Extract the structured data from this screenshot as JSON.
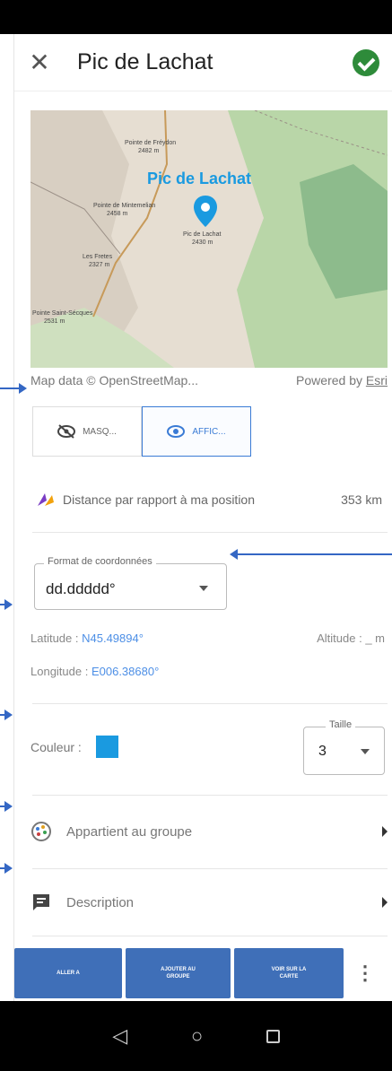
{
  "header": {
    "title": "Pic de Lachat"
  },
  "map": {
    "marker_title": "Pic de Lachat",
    "labels": [
      {
        "name": "Pointe de Fréydon",
        "alt": "2482 m"
      },
      {
        "name": "Pointe de Mintemelian",
        "alt": "2458 m"
      },
      {
        "name": "Pic de Lachat",
        "alt": "2430 m"
      },
      {
        "name": "Les Fretes",
        "alt": "2327 m"
      },
      {
        "name": "Pointe Saint-Sécques",
        "alt": "2531 m"
      }
    ],
    "credit_left": "Map data © OpenStreetMap...",
    "credit_right_prefix": "Powered by ",
    "credit_right_link": "Esri"
  },
  "visibility": {
    "hide_label": "MASQ...",
    "show_label": "AFFIC..."
  },
  "distance": {
    "label": "Distance par rapport à ma position",
    "value": "353 km"
  },
  "coords": {
    "format_legend": "Format de coordonnées",
    "format_value": "dd.ddddd°",
    "latitude_label": "Latitude : ",
    "latitude_value": "N45.49894°",
    "longitude_label": "Longitude : ",
    "longitude_value": "E006.38680°",
    "altitude_label": "Altitude : _ m"
  },
  "color": {
    "label": "Couleur :",
    "value": "#1a9ae0"
  },
  "size": {
    "legend": "Taille",
    "value": "3"
  },
  "group": {
    "label": "Appartient au groupe"
  },
  "description": {
    "label": "Description"
  },
  "actions": {
    "goto": "ALLER A",
    "add_group": "AJOUTER AU\nGROUPE",
    "view_map": "VOIR SUR LA\nCARTE"
  },
  "nav": {
    "back": "◁",
    "home": "○"
  }
}
